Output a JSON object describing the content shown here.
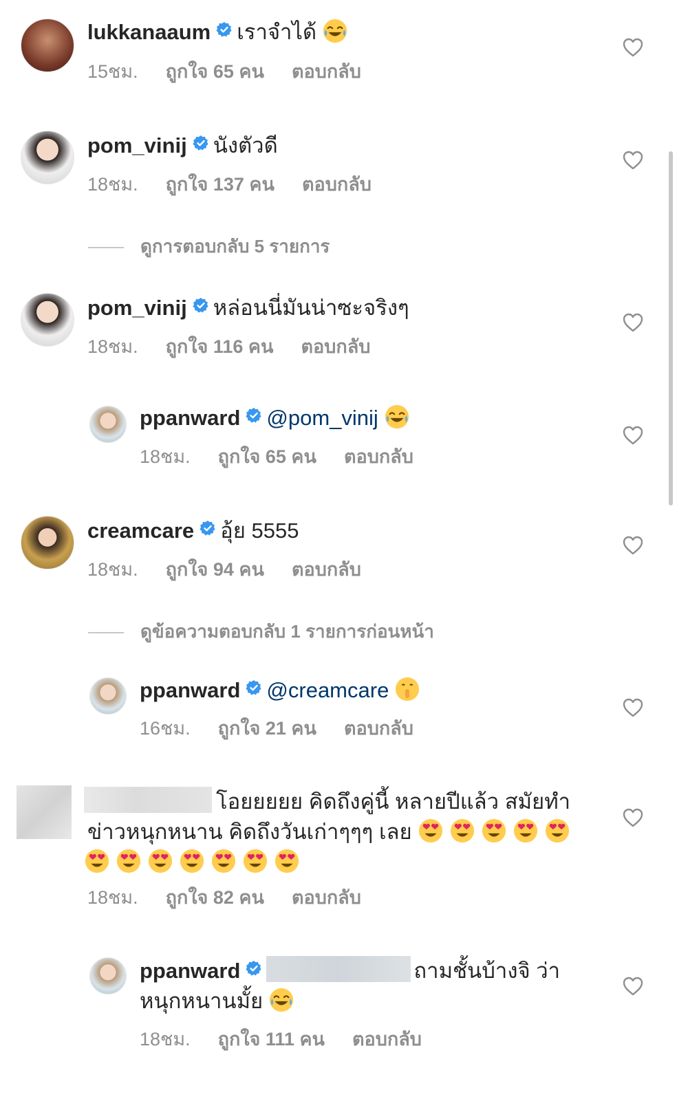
{
  "comments": [
    {
      "user": "lukkanaaum",
      "text": "เราจำได้",
      "emoji": "😂",
      "time": "15ชม.",
      "likes": "ถูกใจ 65 คน",
      "reply": "ตอบกลับ"
    },
    {
      "user": "pom_vinij",
      "text": "นังตัวดี",
      "time": "18ชม.",
      "likes": "ถูกใจ 137 คน",
      "reply": "ตอบกลับ"
    },
    {
      "user": "pom_vinij",
      "text": "หล่อนนี่มันน่าซะจริงๆ",
      "time": "18ชม.",
      "likes": "ถูกใจ 116 คน",
      "reply": "ตอบกลับ"
    },
    {
      "user": "ppanward",
      "mention": "@pom_vinij",
      "emoji": "😂",
      "time": "18ชม.",
      "likes": "ถูกใจ 65 คน",
      "reply": "ตอบกลับ"
    },
    {
      "user": "creamcare",
      "text": "อุ้ย 5555",
      "time": "18ชม.",
      "likes": "ถูกใจ 94 คน",
      "reply": "ตอบกลับ"
    },
    {
      "user": "ppanward",
      "mention": "@creamcare",
      "emoji": "🤫",
      "time": "16ชม.",
      "likes": "ถูกใจ 21 คน",
      "reply": "ตอบกลับ"
    },
    {
      "text_line1": "โอยยยยย คิดถึงคู่นี้ หลายปีแล้ว สมัยทำ",
      "text_line2": "ข่าวหนุกหนาน คิดถึงวันเก่าๆๆๆ เลย",
      "emoji": "😍",
      "time": "18ชม.",
      "likes": "ถูกใจ 82 คน",
      "reply": "ตอบกลับ"
    },
    {
      "user": "ppanward",
      "text_line1": "ถามชั้นบ้างจิ ว่า",
      "text_line2": "หนุกหนานมั้ย",
      "emoji": "😂",
      "time": "18ชม.",
      "likes": "ถูกใจ 111 คน",
      "reply": "ตอบกลับ"
    }
  ],
  "view_replies": [
    "ดูการตอบกลับ 5 รายการ",
    "ดูข้อความตอบกลับ 1 รายการก่อนหน้า"
  ],
  "colors": {
    "verified": "#3897f0",
    "mention": "#00376b",
    "meta": "#8e8e8e",
    "text": "#262626"
  },
  "icons": {
    "heart": "heart-outline-icon",
    "verified": "verified-badge-icon"
  }
}
